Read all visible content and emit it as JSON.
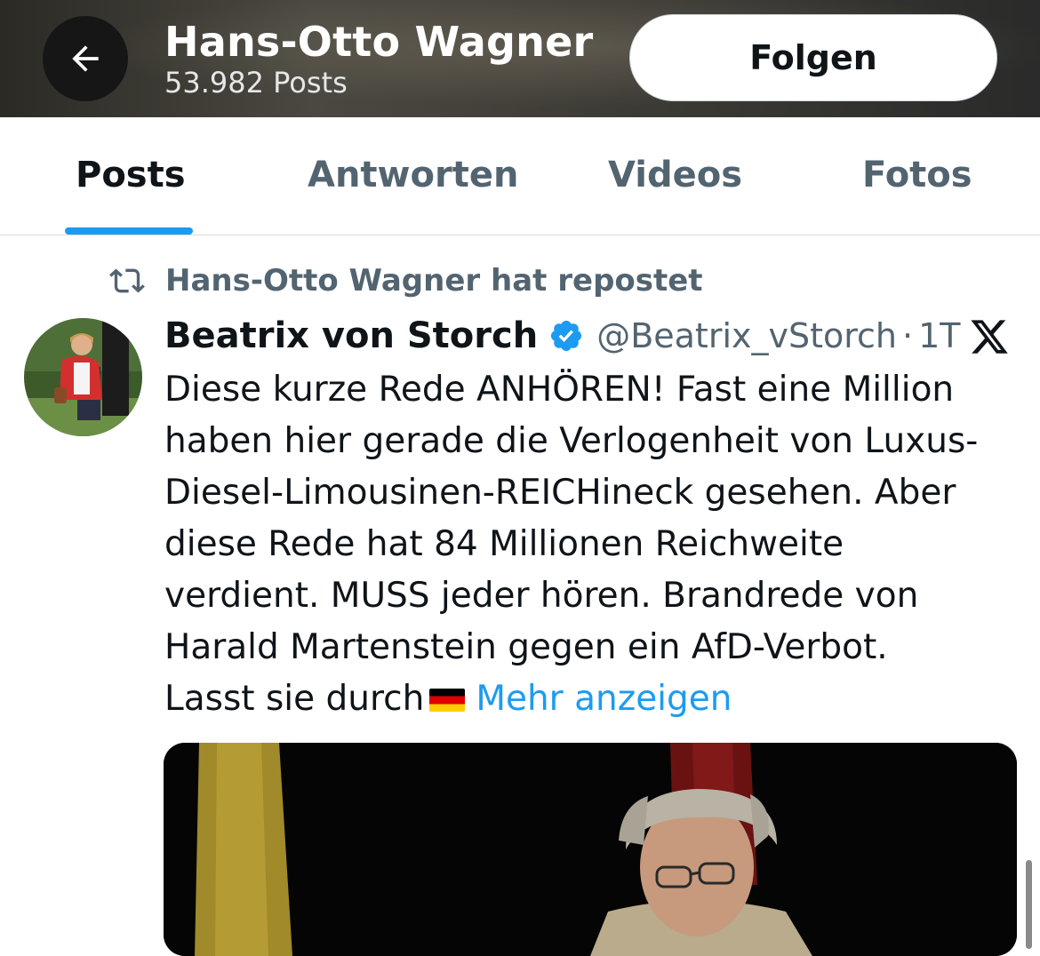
{
  "header": {
    "name": "Hans-Otto Wagner",
    "post_count": "53.982 Posts",
    "follow_label": "Folgen"
  },
  "tabs": [
    {
      "label": "Posts",
      "active": true
    },
    {
      "label": "Antworten",
      "active": false
    },
    {
      "label": "Videos",
      "active": false
    },
    {
      "label": "Fotos",
      "active": false
    }
  ],
  "repost": {
    "label": "Hans-Otto Wagner hat repostet",
    "icon": "repost-icon"
  },
  "tweet": {
    "author_name": "Beatrix von Storch",
    "handle": "@Beatrix_vStorch",
    "separator": "·",
    "time": "1T",
    "lines": [
      "Diese kurze Rede ANHÖREN! Fast eine Million",
      "haben hier gerade die Verlogenheit von Luxus-",
      "Diesel-Limousinen-REICHineck gesehen. Aber",
      "diese Rede hat 84 Millionen Reichweite",
      "verdient. MUSS jeder hören. Brandrede von",
      "Harald Martenstein gegen ein AfD-Verbot.",
      "Lasst sie durch"
    ],
    "more_label": "Mehr anzeigen"
  },
  "colors": {
    "accent": "#1d9bf0",
    "text_primary": "#0f1419",
    "text_secondary": "#536471"
  }
}
